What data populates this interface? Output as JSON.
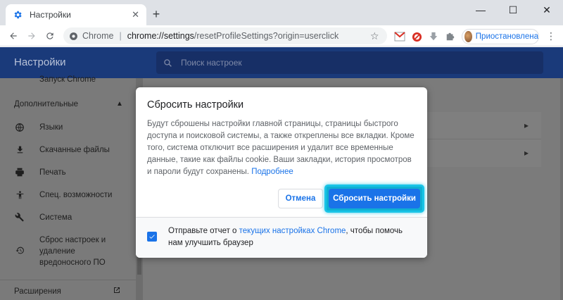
{
  "browser": {
    "tab_title": "Настройки",
    "tab_close": "✕",
    "new_tab": "+",
    "window_controls": {
      "minimize": "—",
      "maximize": "☐",
      "close": "✕"
    },
    "site_label": "Chrome",
    "url_main": "chrome://settings",
    "url_rest": "/resetProfileSettings?origin=userclick",
    "profile_label": "Приостановлена",
    "accent": "#1a73e8"
  },
  "settings": {
    "header_title": "Настройки",
    "search_placeholder": "Поиск настроек",
    "sidebar": {
      "partial_item": "Запуск Chrome",
      "section_advanced": "Дополнительные",
      "items": [
        {
          "label": "Языки",
          "icon": "globe-icon"
        },
        {
          "label": "Скачанные файлы",
          "icon": "download-icon"
        },
        {
          "label": "Печать",
          "icon": "print-icon"
        },
        {
          "label": "Спец. возможности",
          "icon": "accessibility-icon"
        },
        {
          "label": "Система",
          "icon": "wrench-icon"
        },
        {
          "label": "Сброс настроек и удаление вредоносного ПО",
          "icon": "reset-icon"
        }
      ],
      "extensions": "Расширения"
    }
  },
  "dialog": {
    "title": "Сбросить настройки",
    "body": "Будут сброшены настройки главной страницы, страницы быстрого доступа и поисковой системы, а также откреплены все вкладки. Кроме того, система отключит все расширения и удалит все временные данные, такие как файлы cookie. Ваши закладки, история просмотров и пароли будут сохранены.",
    "learn_more": "Подробнее",
    "cancel_label": "Отмена",
    "reset_label": "Сбросить настройки",
    "footer_prefix": "Отправьте отчет о ",
    "footer_link": "текущих настройках Chrome",
    "footer_suffix": ", чтобы помочь нам улучшить браузер",
    "checkbox_checked": true,
    "highlight_color": "#19c4e6"
  }
}
